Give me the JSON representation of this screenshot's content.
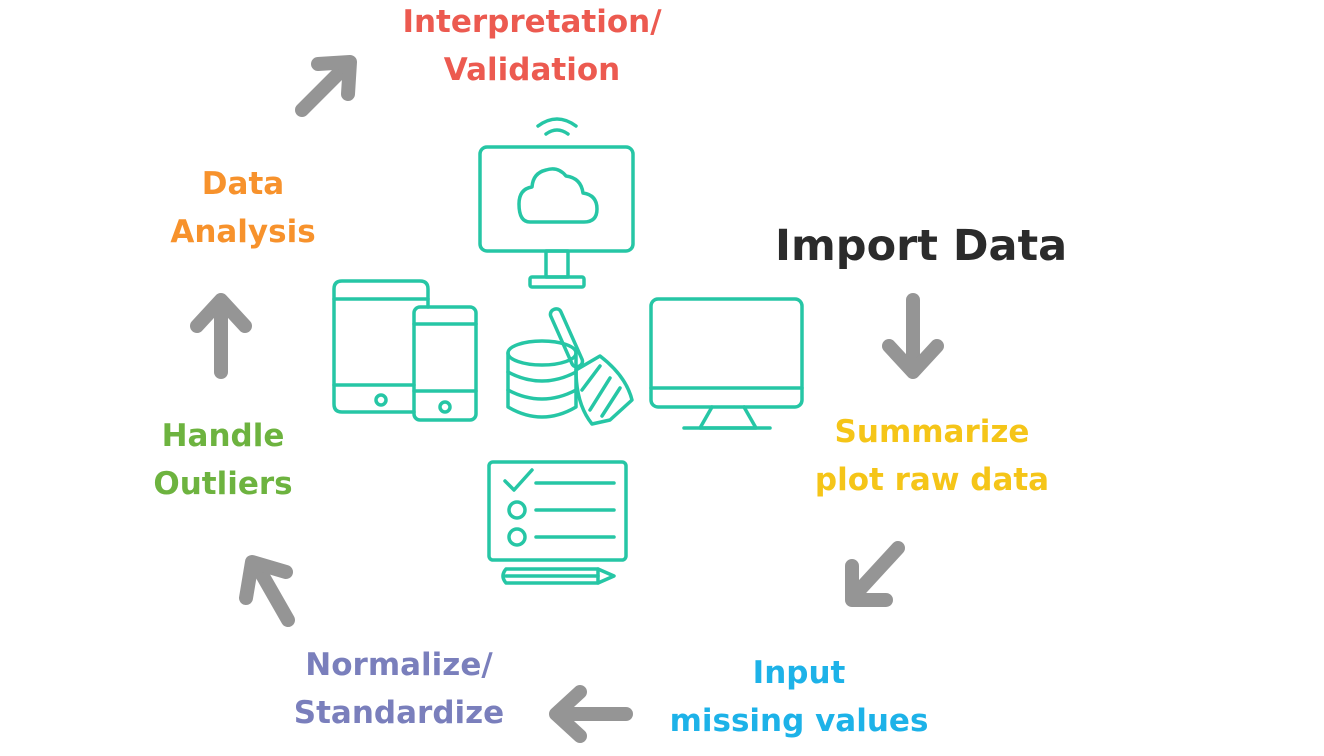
{
  "colors": {
    "import": "#2b2b2b",
    "summarize": "#f5c518",
    "input": "#1db2e8",
    "normalize": "#7a7fbc",
    "outliers": "#6db33f",
    "analysis": "#f7922c",
    "interpretation": "#ec5a50",
    "arrow": "#959595",
    "icon": "#26c6a5"
  },
  "steps": [
    {
      "id": "import",
      "lines": [
        "Import Data"
      ]
    },
    {
      "id": "summarize",
      "lines": [
        "Summarize",
        "plot raw data"
      ]
    },
    {
      "id": "input",
      "lines": [
        "Input",
        "missing values"
      ]
    },
    {
      "id": "normalize",
      "lines": [
        "Normalize/",
        "Standardize"
      ]
    },
    {
      "id": "outliers",
      "lines": [
        "Handle",
        "Outliers"
      ]
    },
    {
      "id": "analysis",
      "lines": [
        "Data",
        "Analysis"
      ]
    },
    {
      "id": "interpretation",
      "lines": [
        "Interpretation/",
        "Validation"
      ]
    }
  ],
  "arrows": [
    "down",
    "down-left",
    "left",
    "up-left",
    "up",
    "up-right"
  ],
  "icons": [
    "monitor-cloud-icon",
    "tablet-icon",
    "phone-icon",
    "database-icon",
    "broom-icon",
    "desktop-monitor-icon",
    "checklist-board-icon",
    "pencil-icon"
  ]
}
